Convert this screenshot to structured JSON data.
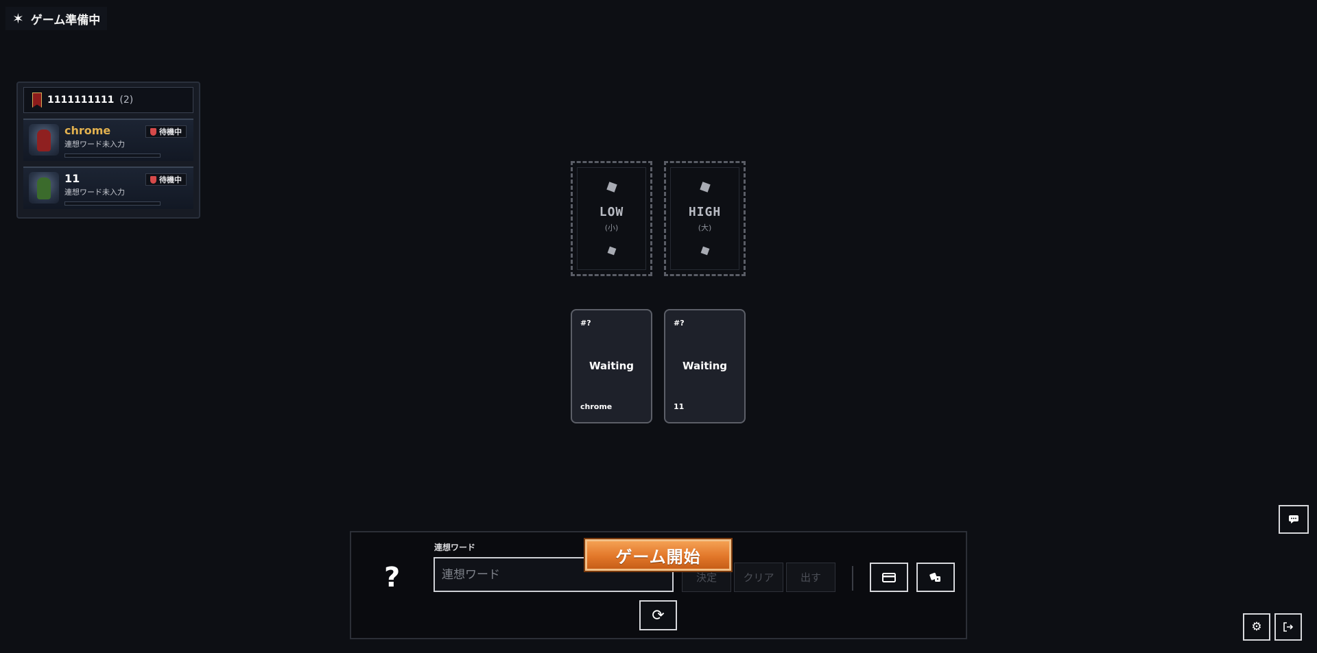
{
  "status": {
    "icon": "star-icon",
    "text": "ゲーム準備中"
  },
  "team": {
    "name": "1111111111",
    "count": "(2)"
  },
  "players": [
    {
      "name": "chrome",
      "sub": "連想ワード未入力",
      "badge": "待機中",
      "name_color": "#e2b14f"
    },
    {
      "name": "11",
      "sub": "連想ワード未入力",
      "badge": "待機中",
      "name_color": "#ffffff"
    }
  ],
  "slots": {
    "low": {
      "label": "LOW",
      "sub": "(小)"
    },
    "high": {
      "label": "HIGH",
      "sub": "(大)"
    }
  },
  "cards": [
    {
      "num": "#?",
      "state": "Waiting",
      "owner": "chrome"
    },
    {
      "num": "#?",
      "state": "Waiting",
      "owner": "11"
    }
  ],
  "controls": {
    "question": "?",
    "word_label": "連想ワード",
    "word_placeholder": "連想ワード",
    "decide": "決定",
    "clear": "クリア",
    "submit": "出す",
    "start": "ゲーム開始"
  },
  "colors": {
    "accent": "#e2772a",
    "gold": "#e2b14f",
    "background": "#0d0f14"
  }
}
